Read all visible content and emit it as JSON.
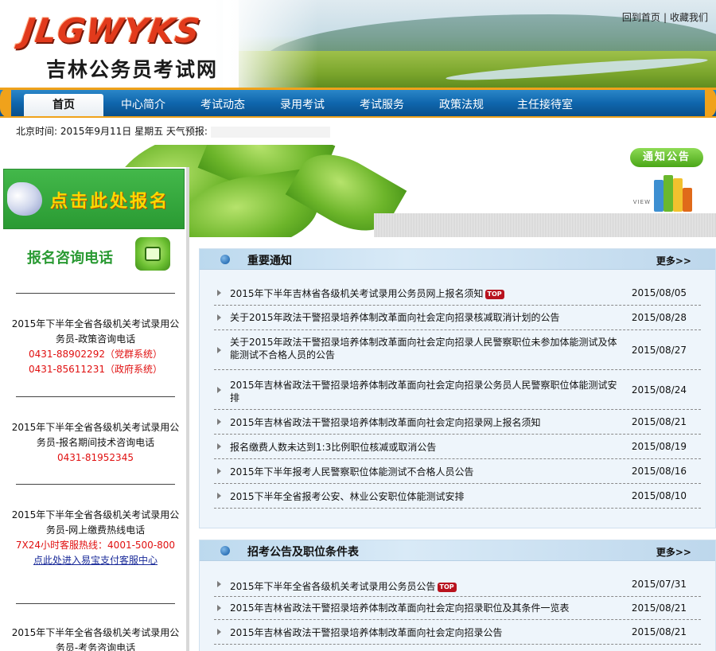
{
  "header": {
    "logo_text": "JLGWYKS",
    "site_name": "吉林公务员考试网",
    "links": [
      "回到首页",
      "收藏我们"
    ]
  },
  "nav": {
    "items": [
      "首页",
      "中心简介",
      "考试动态",
      "录用考试",
      "考试服务",
      "政策法规",
      "主任接待室"
    ],
    "active_index": 0
  },
  "timebar": {
    "text": "北京时间: 2015年9月11日  星期五  天气预报:"
  },
  "notice_banner": {
    "tag": "通知公告",
    "view_label": "VIEW"
  },
  "left": {
    "signup_label": "点击此处报名",
    "hotline_title": "报名咨询电话",
    "contacts": [
      {
        "title": "2015年下半年全省各级机关考试录用公务员-政策咨询电话",
        "phones": [
          "0431-88902292（党群系统）",
          "0431-85611231（政府系统）"
        ]
      },
      {
        "title": "2015年下半年全省各级机关考试录用公务员-报名期间技术咨询电话",
        "phones": [
          "0431-81952345"
        ]
      },
      {
        "title": "2015年下半年全省各级机关考试录用公务员-网上缴费热线电话",
        "phones": [
          "7X24小时客服热线：4001-500-800"
        ],
        "link": "点此处进入易宝支付客服中心"
      },
      {
        "title": "2015年下半年全省各级机关考试录用公务员-考务咨询电话"
      }
    ]
  },
  "important": {
    "title": "重要通知",
    "more": "更多>>",
    "items": [
      {
        "text": "2015年下半年吉林省各级机关考试录用公务员网上报名须知",
        "date": "2015/08/05",
        "top": "TOP"
      },
      {
        "text": "关于2015年政法干警招录培养体制改革面向社会定向招录核减取消计划的公告",
        "date": "2015/08/28"
      },
      {
        "text": "关于2015年政法干警招录培养体制改革面向社会定向招录人民警察职位未参加体能测试及体能测试不合格人员的公告",
        "date": "2015/08/27"
      },
      {
        "text": "2015年吉林省政法干警招录培养体制改革面向社会定向招录公务员人民警察职位体能测试安排",
        "date": "2015/08/24"
      },
      {
        "text": "2015年吉林省政法干警招录培养体制改革面向社会定向招录网上报名须知",
        "date": "2015/08/21"
      },
      {
        "text": "报名缴费人数未达到1:3比例职位核减或取消公告",
        "date": "2015/08/19"
      },
      {
        "text": "2015年下半年报考人民警察职位体能测试不合格人员公告",
        "date": "2015/08/16"
      },
      {
        "text": "2015下半年全省报考公安、林业公安职位体能测试安排",
        "date": "2015/08/10"
      }
    ]
  },
  "recruit": {
    "title": "招考公告及职位条件表",
    "more": "更多>>",
    "items": [
      {
        "text": "2015年下半年全省各级机关考试录用公务员公告",
        "date": "2015/07/31",
        "top": "TOP"
      },
      {
        "text": "2015年吉林省政法干警招录培养体制改革面向社会定向招录职位及其条件一览表",
        "date": "2015/08/21"
      },
      {
        "text": "2015年吉林省政法干警招录培养体制改革面向社会定向招录公告",
        "date": "2015/08/21"
      }
    ]
  }
}
